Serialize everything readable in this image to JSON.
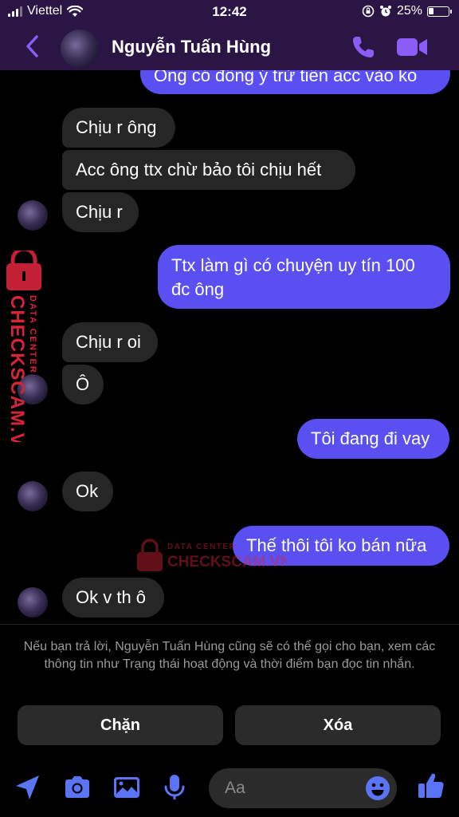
{
  "status_bar": {
    "carrier": "Viettel",
    "time": "12:42",
    "battery": "25%",
    "battery_level": 0.25
  },
  "header": {
    "contact_name": "Nguyễn Tuấn Hùng",
    "back_icon": "chevron-left-icon",
    "call_icon": "phone-icon",
    "video_icon": "video-camera-icon"
  },
  "messages": [
    {
      "side": "out",
      "text": "Ông có đồng ý trừ tiền acc vào ko"
    },
    {
      "side": "in",
      "text": "Chịu r ông"
    },
    {
      "side": "in",
      "text": "Acc ông ttx chừ bảo tôi chịu hết"
    },
    {
      "side": "in",
      "text": "Chịu r"
    },
    {
      "side": "out",
      "text": "Ttx làm gì có chuyện uy tín 100"
    },
    {
      "side": "out",
      "text": "đc ông"
    },
    {
      "side": "in",
      "text": "Chịu r oi"
    },
    {
      "side": "in",
      "text": "Ô"
    },
    {
      "side": "out",
      "text": "Tôi đang đi vay"
    },
    {
      "side": "in",
      "text": "Ok"
    },
    {
      "side": "out",
      "text": "Thế thôi tôi ko bán nữa"
    },
    {
      "side": "in",
      "text": "Ok v th ô"
    }
  ],
  "watermark": {
    "label_top": "DATA CENTER",
    "label_main": "CHECKSCAM.VN",
    "color": "#d8243a"
  },
  "notice": "Nếu bạn trả lời, Nguyễn Tuấn Hùng cũng sẽ có thể gọi cho bạn, xem các thông tin như Trạng thái hoạt động và thời điểm bạn đọc tin nhắn.",
  "actions": {
    "block_label": "Chặn",
    "delete_label": "Xóa"
  },
  "composer": {
    "placeholder": "Aa",
    "icons": [
      "location-arrow-icon",
      "camera-icon",
      "photo-icon",
      "microphone-icon",
      "emoji-icon",
      "thumbs-up-icon"
    ]
  },
  "colors": {
    "accent": "#8b5cf6",
    "outgoing_bubble": "#5a4ff0",
    "incoming_bubble": "#262626",
    "header_bg": "#2a1545"
  }
}
